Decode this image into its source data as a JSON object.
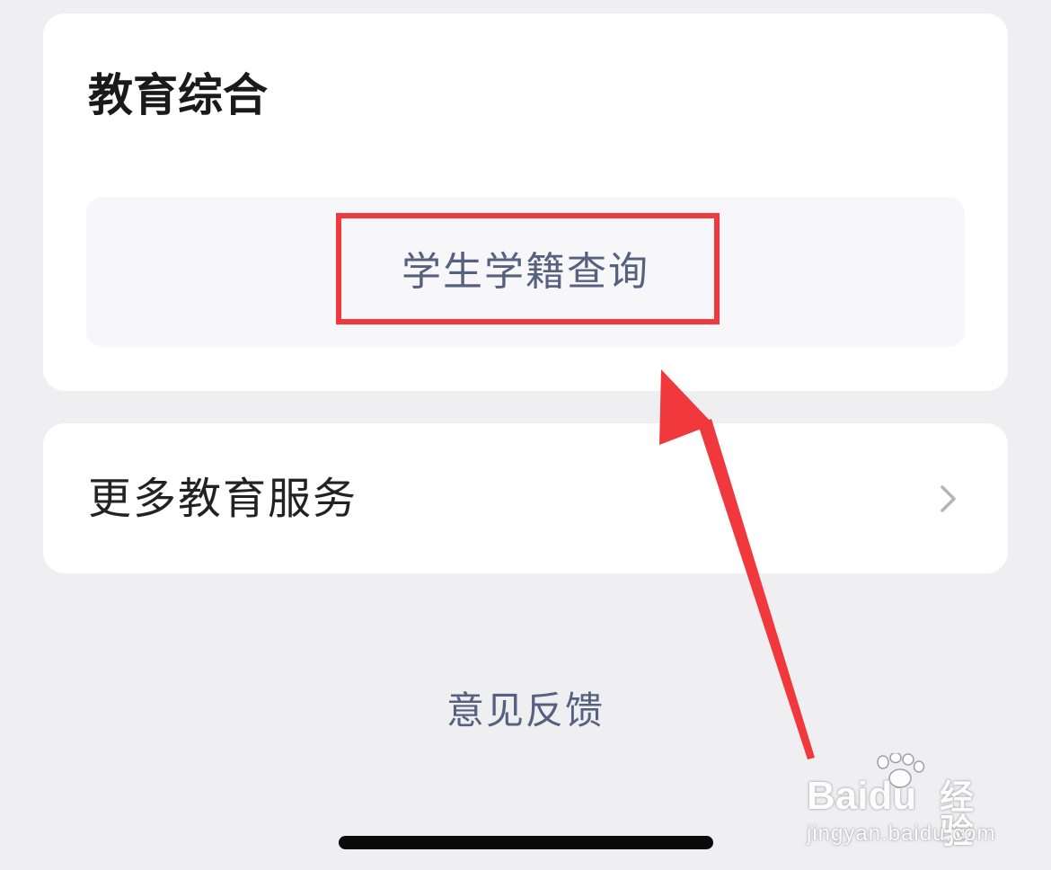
{
  "education_section": {
    "title": "教育综合",
    "services": [
      {
        "label": "学生学籍查询"
      }
    ]
  },
  "more_services": {
    "label": "更多教育服务",
    "icon": "chevron-right-icon"
  },
  "feedback": {
    "label": "意见反馈"
  },
  "annotation": {
    "highlight_color": "#f0383d",
    "arrow_color": "#f0383d"
  },
  "watermark": {
    "brand": "Baidu",
    "brand_cn": "经验",
    "url": "jingyan.baidu.com"
  },
  "colors": {
    "page_background": "#efeff1",
    "card_background": "#ffffff",
    "tile_background": "#f7f7fa",
    "link_text": "#56617f"
  }
}
